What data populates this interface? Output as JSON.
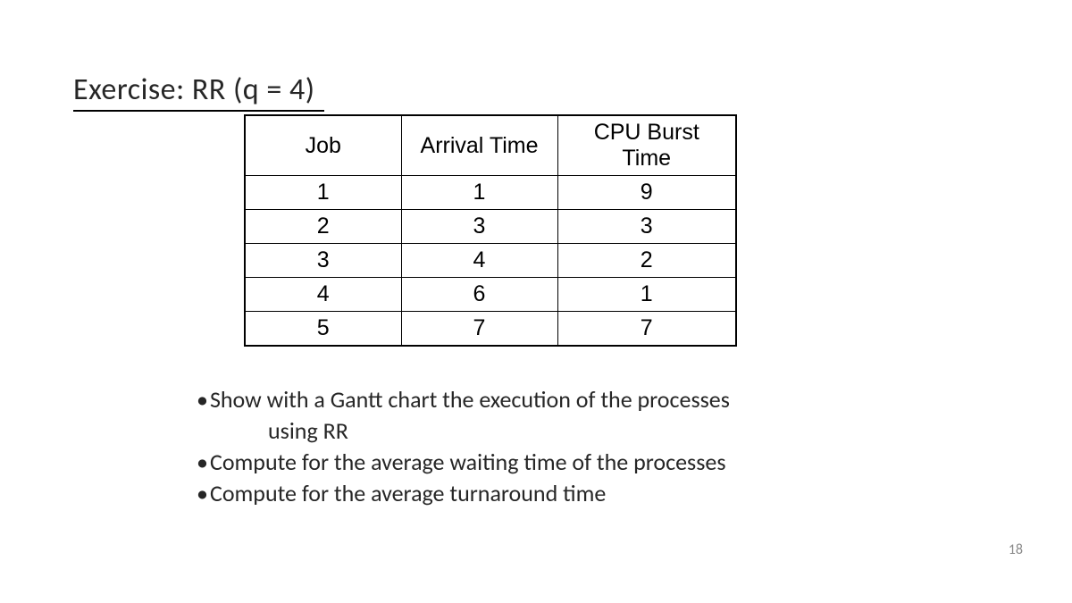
{
  "title": "Exercise: RR  (q = 4)",
  "table": {
    "headers": [
      "Job",
      "Arrival Time",
      "CPU Burst Time"
    ],
    "rows": [
      [
        "1",
        "1",
        "9"
      ],
      [
        "2",
        "3",
        "3"
      ],
      [
        "3",
        "4",
        "2"
      ],
      [
        "4",
        "6",
        "1"
      ],
      [
        "5",
        "7",
        "7"
      ]
    ]
  },
  "bullets": {
    "b1_part1": "Show with a Gantt chart the execution of the processes",
    "b1_part2": "using RR",
    "b2": "Compute for the average waiting time of the processes",
    "b3": "Compute for the average turnaround time"
  },
  "pageNumber": "18",
  "chart_data": {
    "type": "table",
    "title": "Exercise: RR (q = 4)",
    "columns": [
      "Job",
      "Arrival Time",
      "CPU Burst Time"
    ],
    "rows": [
      {
        "Job": 1,
        "Arrival Time": 1,
        "CPU Burst Time": 9
      },
      {
        "Job": 2,
        "Arrival Time": 3,
        "CPU Burst Time": 3
      },
      {
        "Job": 3,
        "Arrival Time": 4,
        "CPU Burst Time": 2
      },
      {
        "Job": 4,
        "Arrival Time": 6,
        "CPU Burst Time": 1
      },
      {
        "Job": 5,
        "Arrival Time": 7,
        "CPU Burst Time": 7
      }
    ]
  }
}
